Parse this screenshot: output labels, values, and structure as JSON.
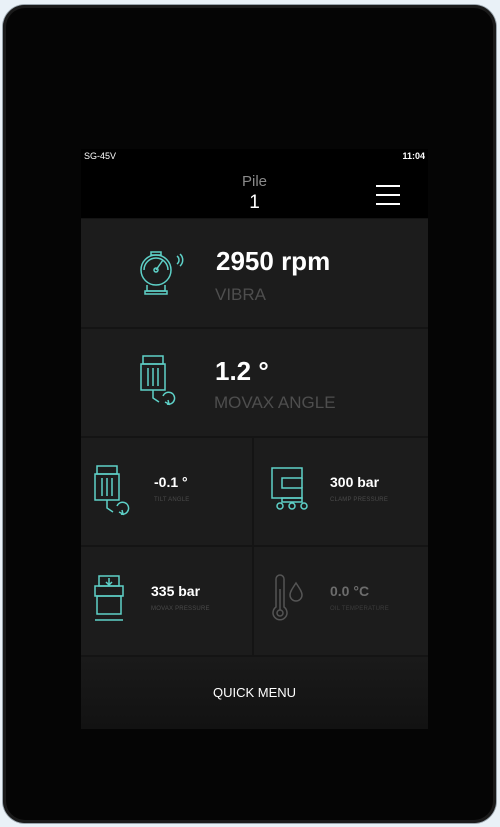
{
  "status_bar": {
    "model": "SG-45V",
    "time": "11:04"
  },
  "header": {
    "pile_label": "Pile",
    "pile_number": "1",
    "menu_icon": "hamburger-menu-icon"
  },
  "tiles": {
    "vibra": {
      "value": "2950 rpm",
      "label": "VIBRA",
      "icon": "tachometer-icon"
    },
    "movax_angle": {
      "value": "1.2 °",
      "label": "MOVAX ANGLE",
      "icon": "movax-angle-icon"
    },
    "tilt_angle": {
      "value": "-0.1 °",
      "label": "TILT ANGLE",
      "icon": "tilt-angle-icon"
    },
    "clamp_pressure": {
      "value": "300 bar",
      "label": "CLAMP PRESSURE",
      "icon": "clamp-icon"
    },
    "movax_pressure": {
      "value": "335 bar",
      "label": "MOVAX PRESSURE",
      "icon": "movax-pressure-icon"
    },
    "oil_temperature": {
      "value": "0.0 °C",
      "label": "OIL TEMPERATURE",
      "icon": "thermometer-oil-icon"
    }
  },
  "quick_menu": {
    "label": "QUICK MENU"
  },
  "colors": {
    "accent": "#5ed1c8",
    "screen_bg": "#141414",
    "tile_bg": "#1c1c1c",
    "header_bg": "#000000",
    "label_gray": "#4e4e4e",
    "disabled_icon": "#555555"
  }
}
